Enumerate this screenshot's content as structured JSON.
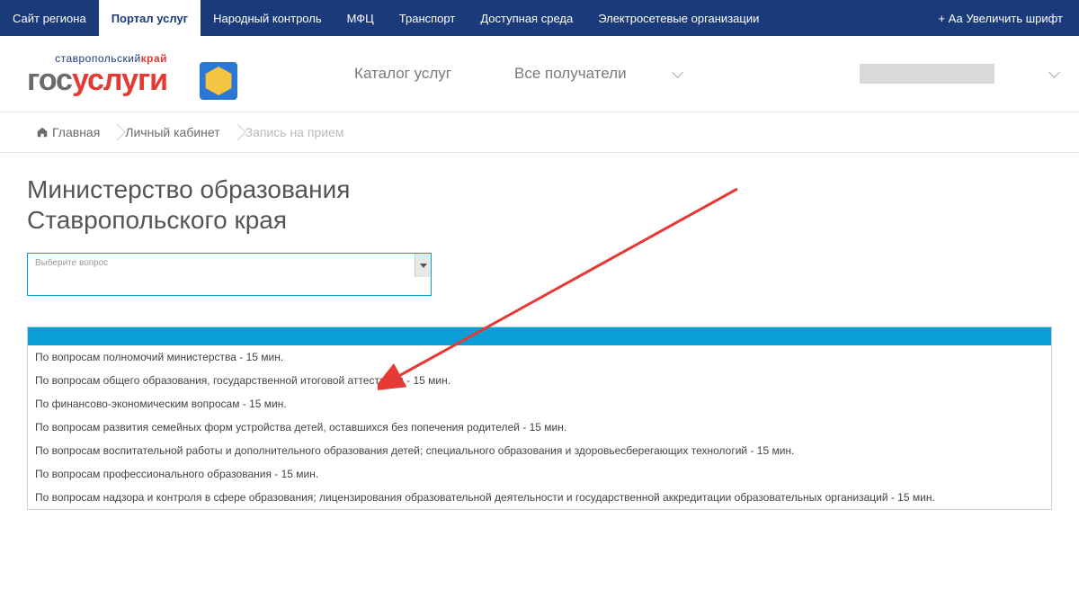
{
  "top_nav": {
    "items": [
      {
        "label": "Сайт региона"
      },
      {
        "label": "Портал услуг",
        "active": true
      },
      {
        "label": "Народный контроль"
      },
      {
        "label": "МФЦ"
      },
      {
        "label": "Транспорт"
      },
      {
        "label": "Доступная среда"
      },
      {
        "label": "Электросетевые организации"
      }
    ],
    "font_size": "+ Аа Увеличить шрифт"
  },
  "logo": {
    "tagline_part1": "ставропольский",
    "tagline_part2": "край",
    "word_gos": "гос",
    "word_uslugi": "услуги"
  },
  "header_menu": {
    "catalog": "Каталог услуг",
    "recipients": "Все получатели"
  },
  "breadcrumb": {
    "home": "Главная",
    "account": "Личный кабинет",
    "current": "Запись на прием"
  },
  "page_title_line1": "Министерство образования",
  "page_title_line2": "Ставропольского края",
  "select_placeholder": "Выберите вопрос",
  "dropdown_items": [
    "По вопросам полномочий министерства - 15 мин.",
    "По вопросам общего образования, государственной итоговой аттестации - 15 мин.",
    "По финансово-экономическим вопросам - 15 мин.",
    "По вопросам развития семейных форм устройства детей, оставшихся без попечения родителей - 15 мин.",
    "По вопросам воспитательной работы и дополнительного образования детей; специального образования и здоровьесберегающих технологий - 15 мин.",
    "По вопросам профессионального образования - 15 мин.",
    "По вопросам надзора и контроля в сфере образования; лицензирования образовательной деятельности и государственной аккредитации образовательных организаций - 15 мин."
  ]
}
